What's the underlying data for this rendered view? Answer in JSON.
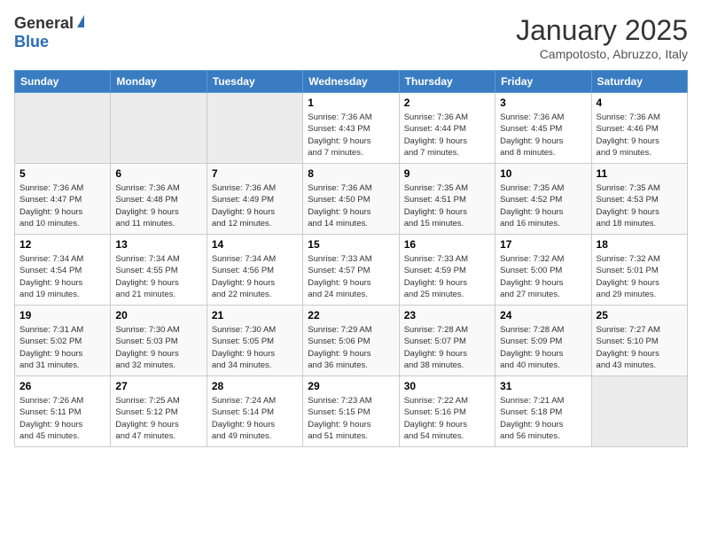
{
  "header": {
    "logo": {
      "general": "General",
      "blue": "Blue"
    },
    "title": "January 2025",
    "location": "Campotosto, Abruzzo, Italy"
  },
  "weekdays": [
    "Sunday",
    "Monday",
    "Tuesday",
    "Wednesday",
    "Thursday",
    "Friday",
    "Saturday"
  ],
  "weeks": [
    [
      {
        "day": null
      },
      {
        "day": null
      },
      {
        "day": null
      },
      {
        "day": "1",
        "sunrise": "7:36 AM",
        "sunset": "4:43 PM",
        "daylight": "9 hours and 7 minutes."
      },
      {
        "day": "2",
        "sunrise": "7:36 AM",
        "sunset": "4:44 PM",
        "daylight": "9 hours and 7 minutes."
      },
      {
        "day": "3",
        "sunrise": "7:36 AM",
        "sunset": "4:45 PM",
        "daylight": "9 hours and 8 minutes."
      },
      {
        "day": "4",
        "sunrise": "7:36 AM",
        "sunset": "4:46 PM",
        "daylight": "9 hours and 9 minutes."
      }
    ],
    [
      {
        "day": "5",
        "sunrise": "7:36 AM",
        "sunset": "4:47 PM",
        "daylight": "9 hours and 10 minutes."
      },
      {
        "day": "6",
        "sunrise": "7:36 AM",
        "sunset": "4:48 PM",
        "daylight": "9 hours and 11 minutes."
      },
      {
        "day": "7",
        "sunrise": "7:36 AM",
        "sunset": "4:49 PM",
        "daylight": "9 hours and 12 minutes."
      },
      {
        "day": "8",
        "sunrise": "7:36 AM",
        "sunset": "4:50 PM",
        "daylight": "9 hours and 14 minutes."
      },
      {
        "day": "9",
        "sunrise": "7:35 AM",
        "sunset": "4:51 PM",
        "daylight": "9 hours and 15 minutes."
      },
      {
        "day": "10",
        "sunrise": "7:35 AM",
        "sunset": "4:52 PM",
        "daylight": "9 hours and 16 minutes."
      },
      {
        "day": "11",
        "sunrise": "7:35 AM",
        "sunset": "4:53 PM",
        "daylight": "9 hours and 18 minutes."
      }
    ],
    [
      {
        "day": "12",
        "sunrise": "7:34 AM",
        "sunset": "4:54 PM",
        "daylight": "9 hours and 19 minutes."
      },
      {
        "day": "13",
        "sunrise": "7:34 AM",
        "sunset": "4:55 PM",
        "daylight": "9 hours and 21 minutes."
      },
      {
        "day": "14",
        "sunrise": "7:34 AM",
        "sunset": "4:56 PM",
        "daylight": "9 hours and 22 minutes."
      },
      {
        "day": "15",
        "sunrise": "7:33 AM",
        "sunset": "4:57 PM",
        "daylight": "9 hours and 24 minutes."
      },
      {
        "day": "16",
        "sunrise": "7:33 AM",
        "sunset": "4:59 PM",
        "daylight": "9 hours and 25 minutes."
      },
      {
        "day": "17",
        "sunrise": "7:32 AM",
        "sunset": "5:00 PM",
        "daylight": "9 hours and 27 minutes."
      },
      {
        "day": "18",
        "sunrise": "7:32 AM",
        "sunset": "5:01 PM",
        "daylight": "9 hours and 29 minutes."
      }
    ],
    [
      {
        "day": "19",
        "sunrise": "7:31 AM",
        "sunset": "5:02 PM",
        "daylight": "9 hours and 31 minutes."
      },
      {
        "day": "20",
        "sunrise": "7:30 AM",
        "sunset": "5:03 PM",
        "daylight": "9 hours and 32 minutes."
      },
      {
        "day": "21",
        "sunrise": "7:30 AM",
        "sunset": "5:05 PM",
        "daylight": "9 hours and 34 minutes."
      },
      {
        "day": "22",
        "sunrise": "7:29 AM",
        "sunset": "5:06 PM",
        "daylight": "9 hours and 36 minutes."
      },
      {
        "day": "23",
        "sunrise": "7:28 AM",
        "sunset": "5:07 PM",
        "daylight": "9 hours and 38 minutes."
      },
      {
        "day": "24",
        "sunrise": "7:28 AM",
        "sunset": "5:09 PM",
        "daylight": "9 hours and 40 minutes."
      },
      {
        "day": "25",
        "sunrise": "7:27 AM",
        "sunset": "5:10 PM",
        "daylight": "9 hours and 43 minutes."
      }
    ],
    [
      {
        "day": "26",
        "sunrise": "7:26 AM",
        "sunset": "5:11 PM",
        "daylight": "9 hours and 45 minutes."
      },
      {
        "day": "27",
        "sunrise": "7:25 AM",
        "sunset": "5:12 PM",
        "daylight": "9 hours and 47 minutes."
      },
      {
        "day": "28",
        "sunrise": "7:24 AM",
        "sunset": "5:14 PM",
        "daylight": "9 hours and 49 minutes."
      },
      {
        "day": "29",
        "sunrise": "7:23 AM",
        "sunset": "5:15 PM",
        "daylight": "9 hours and 51 minutes."
      },
      {
        "day": "30",
        "sunrise": "7:22 AM",
        "sunset": "5:16 PM",
        "daylight": "9 hours and 54 minutes."
      },
      {
        "day": "31",
        "sunrise": "7:21 AM",
        "sunset": "5:18 PM",
        "daylight": "9 hours and 56 minutes."
      },
      {
        "day": null
      }
    ]
  ],
  "labels": {
    "sunrise": "Sunrise:",
    "sunset": "Sunset:",
    "daylight": "Daylight hours"
  }
}
